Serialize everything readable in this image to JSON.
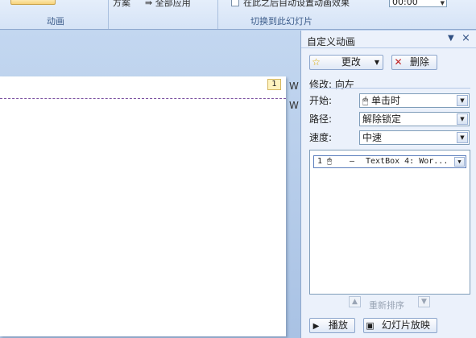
{
  "ribbon": {
    "partial_left": "方案",
    "apply_all": "全部应用",
    "checkbox_partial": "在此之后自动设置动画效果",
    "time_value": "00:00",
    "group_animation": "动画",
    "group_transition": "切换到此幻灯片"
  },
  "slide": {
    "tag": "1",
    "text_top": "W",
    "text_bottom": "W"
  },
  "pane": {
    "title": "自定义动画",
    "change_button": "更改",
    "delete_button": "删除",
    "modify_label": "修改: 向左",
    "start_label": "开始:",
    "start_value": "单击时",
    "path_label": "路径:",
    "path_value": "解除锁定",
    "speed_label": "速度:",
    "speed_value": "中速",
    "item": {
      "number": "1",
      "dash": "—",
      "text": "TextBox 4: Wor..."
    },
    "reorder_label": "重新排序",
    "play_button": "播放",
    "slideshow_button": "幻灯片放映"
  },
  "icons": [
    "star-icon",
    "delete-icon",
    "mouse-icon",
    "up-arrow-icon",
    "down-arrow-icon",
    "play-icon",
    "slideshow-icon",
    "close-icon",
    "pane-menu-icon"
  ]
}
